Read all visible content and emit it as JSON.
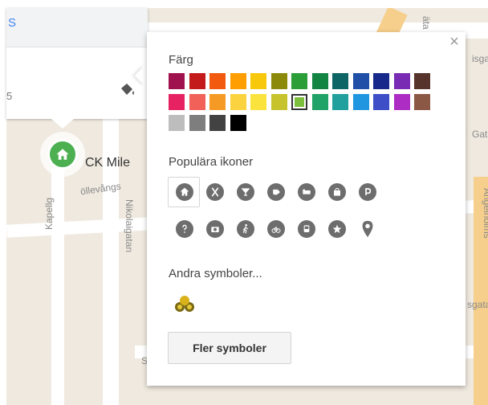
{
  "map": {
    "streets": [
      "Kapellg",
      "Nikolaigatan",
      "öllevångs",
      "Angelholms",
      "sgata",
      "isga",
      "Gata",
      "S",
      "äta"
    ],
    "place_name": "CK Mile",
    "top_letter": "S",
    "top_letter2": "5"
  },
  "panel": {
    "close": "×",
    "color_label": "Färg",
    "popular_label": "Populära ikoner",
    "other_label": "Andra symboler...",
    "more_button": "Fler symboler"
  },
  "colors": {
    "row1": [
      "#a0124d",
      "#c31b1b",
      "#f15a0f",
      "#ff9e00",
      "#f8c80c",
      "#8c8a0b",
      "#2c9e38",
      "#138543",
      "#0d6565",
      "#1f4fa7",
      "#172a8b",
      "#7a2bb3",
      "#56332b"
    ],
    "row2": [
      "#e62263",
      "#f16159",
      "#f59a25",
      "#fbd23f",
      "#fbe33e",
      "#c6c32d",
      "#7cbf3c",
      "#21a266",
      "#21a09e",
      "#2196e0",
      "#3e4ec7",
      "#ac2cc4",
      "#8b5846"
    ],
    "row3": [
      "#bdbdbd",
      "#7e7e7e",
      "#424242",
      "#000000"
    ],
    "selected": "#7cbf3c",
    "marker": "#4caf50"
  },
  "icons": {
    "row1": [
      "home-icon",
      "restaurant-icon",
      "bar-icon",
      "coffee-icon",
      "hotel-icon",
      "shopping-icon",
      "parking-icon"
    ],
    "row2": [
      "help-icon",
      "camera-icon",
      "walking-icon",
      "cycling-icon",
      "bus-icon",
      "star-icon",
      "place-icon"
    ],
    "selected": "home-icon",
    "other": "cyclists-icon"
  }
}
